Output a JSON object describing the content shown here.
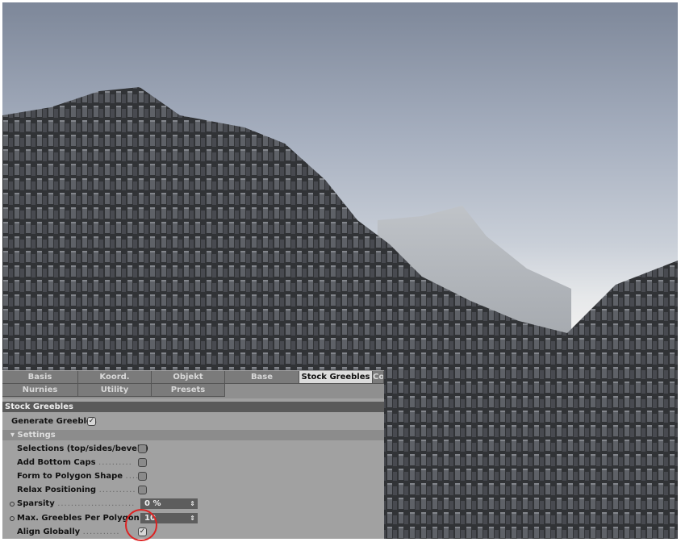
{
  "tabs_row1": [
    "Basis",
    "Koord.",
    "Objekt",
    "Base",
    "Stock Greebles",
    "Co"
  ],
  "tabs_row2": [
    "Nurnies",
    "Utility",
    "Presets"
  ],
  "active_tab": "Stock Greebles",
  "section_title": "Stock Greebles",
  "generate_greebles": {
    "label": "Generate Greebles",
    "checked": true
  },
  "settings_label": "Settings",
  "options": [
    {
      "label": "Selections (top/sides/bevels)",
      "checked": false
    },
    {
      "label": "Add Bottom Caps",
      "checked": false
    },
    {
      "label": "Form to Polygon Shape",
      "checked": false
    },
    {
      "label": "Relax Positioning",
      "checked": false
    }
  ],
  "sparsity": {
    "label": "Sparsity",
    "value": "0 %"
  },
  "max_greebles": {
    "label": "Max. Greebles Per Polygon",
    "value": "10"
  },
  "align_globally": {
    "label": "Align Globally",
    "checked": true
  },
  "highlight_color": "#d22222"
}
